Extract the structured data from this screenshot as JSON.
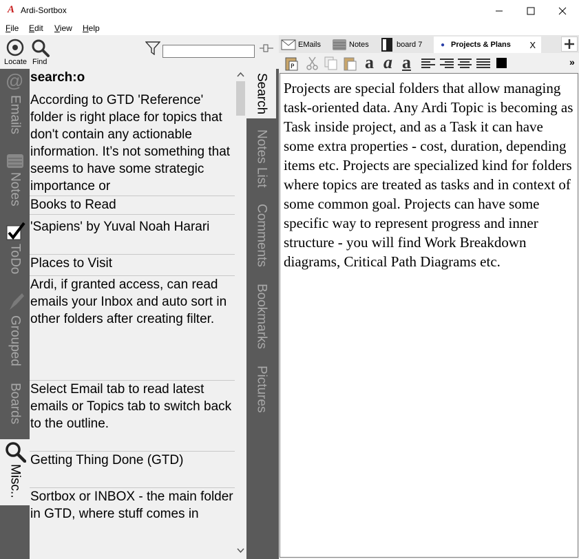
{
  "window": {
    "title": "Ardi-Sortbox",
    "logo": "A"
  },
  "menu": [
    {
      "label": "File",
      "key": "F",
      "rest": "ile"
    },
    {
      "label": "Edit",
      "key": "E",
      "rest": "dit"
    },
    {
      "label": "View",
      "key": "V",
      "rest": "iew"
    },
    {
      "label": "Help",
      "key": "H",
      "rest": "elp"
    }
  ],
  "toolbar": {
    "locate_label": "Locate",
    "find_label": "Find",
    "filter_value": ""
  },
  "left_tabs": [
    "Emails",
    "Notes",
    "ToDo",
    "Grouped",
    "Boards",
    "Misc.."
  ],
  "list": {
    "header": "search:o",
    "items": [
      "According to GTD 'Reference' folder is right place for topics that don't contain any actionable information. It’s not something that seems to have some strategic importance or",
      "Books to Read",
      "'Sapiens' by Yuval Noah Harari",
      "Places to Visit",
      "Ardi, if granted access, can read emails your Inbox and auto sort in other folders after creating filter.",
      "Select Email tab to read latest emails or Topics tab to switch back to the outline.",
      "Getting Thing Done (GTD)",
      "Sortbox or INBOX - the main folder in GTD, where stuff comes in"
    ]
  },
  "mid_tabs": [
    "Search",
    "Notes List",
    "Comments",
    "Bookmarks",
    "Pictures"
  ],
  "right_tabs": [
    {
      "label": "EMails",
      "icon": "envelope-icon"
    },
    {
      "label": "Notes",
      "icon": "notes-icon"
    },
    {
      "label": "board 7",
      "icon": "board-icon"
    },
    {
      "label": "Projects & Plans",
      "icon": "dot-icon",
      "active": true,
      "close": "X"
    }
  ],
  "format_toolbar": {
    "more": "»"
  },
  "note": {
    "text": "Projects are special folders that allow managing task-oriented data. Any Ardi Topic is becoming as Task inside project, and as a Task it can have some extra properties - cost, duration, depending items etc. Projects are specialized kind for folders where topics are treated as tasks and in context of some common goal. Projects can have some specific way to represent progress and inner structure - you will find Work Breakdown diagrams, Critical Path Diagrams etc."
  },
  "colors": {
    "accent_red": "#c81e1e",
    "tab_dark": "#5a5a5a",
    "tab_text": "#a8a8a8"
  }
}
